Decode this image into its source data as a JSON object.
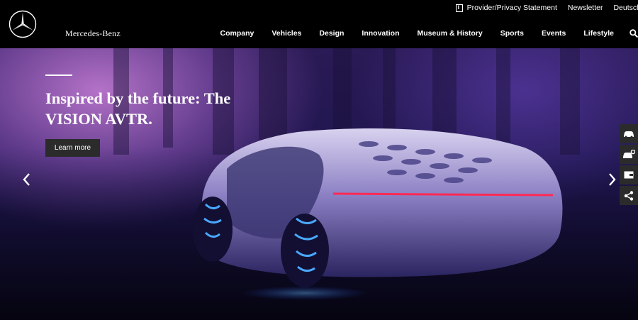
{
  "header": {
    "brand": "Mercedes-Benz",
    "utility": {
      "provider_label": "Provider/Privacy Statement",
      "newsletter_label": "Newsletter",
      "language_label": "Deutsch"
    },
    "nav": [
      "Company",
      "Vehicles",
      "Design",
      "Innovation",
      "Museum & History",
      "Sports",
      "Events",
      "Lifestyle"
    ]
  },
  "hero": {
    "title": "Inspired by the future: The VISION AVTR.",
    "cta_label": "Learn more"
  },
  "side_tools": [
    "car-icon",
    "car-config-icon",
    "wallet-icon",
    "share-icon"
  ],
  "colors": {
    "header_bg": "#000000",
    "button_bg": "#2b2b2b",
    "accent_red": "#ff2a55",
    "accent_blue": "#4aa8ff"
  }
}
